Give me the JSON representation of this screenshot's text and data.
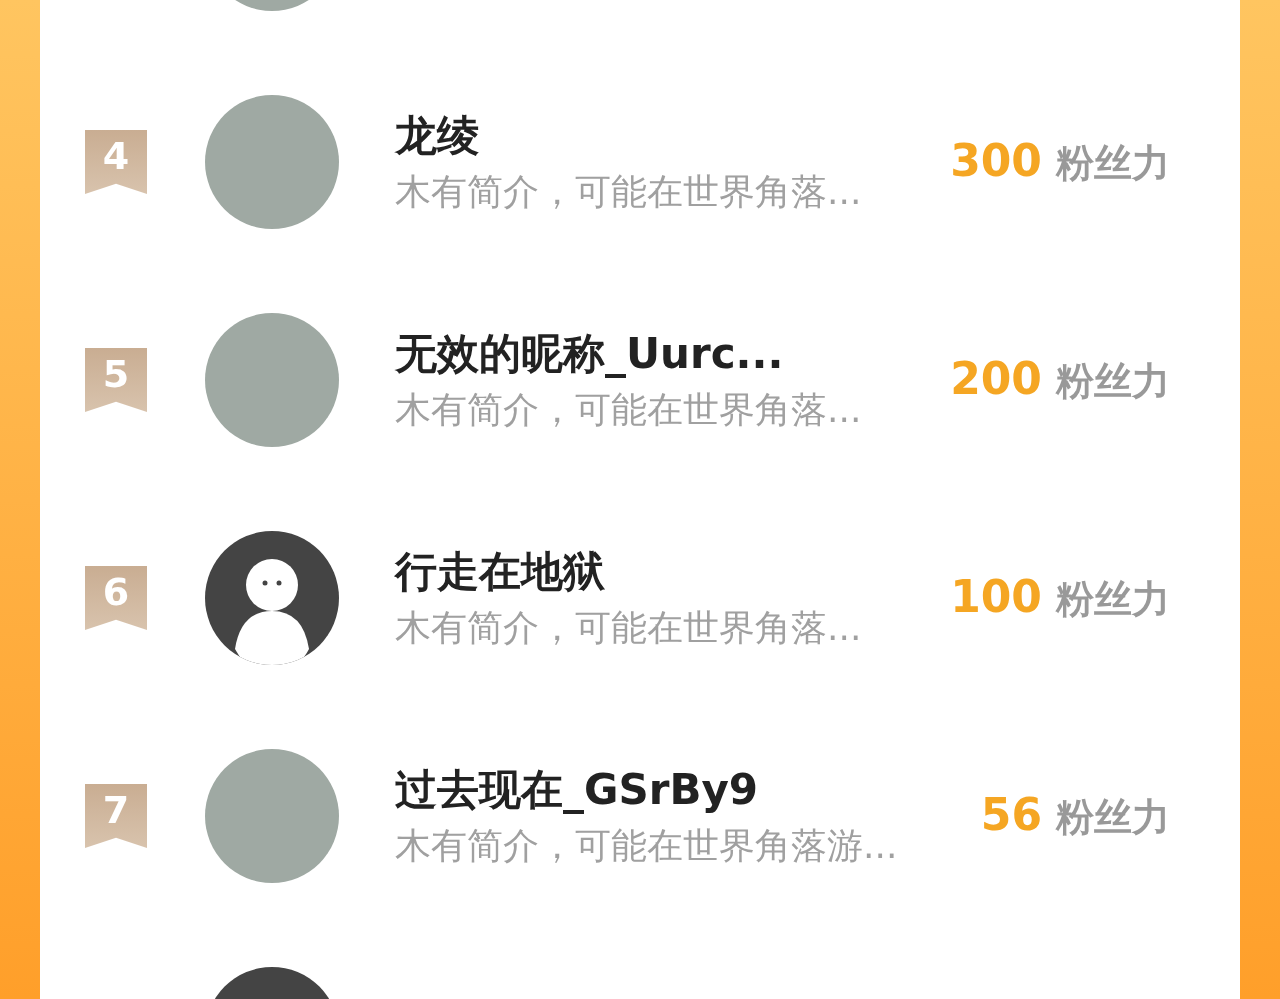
{
  "rows": [
    {
      "kind": "photo"
    },
    {
      "rank": "4",
      "kind": "photo",
      "name": "龙绫",
      "bio": "木有简介，可能在世界角落...",
      "score": "300",
      "unit": "粉丝力"
    },
    {
      "rank": "5",
      "kind": "photo",
      "name": "无效的昵称_Uurc...",
      "bio": "木有简介，可能在世界角落...",
      "score": "200",
      "unit": "粉丝力"
    },
    {
      "rank": "6",
      "kind": "default",
      "name": "行走在地狱",
      "bio": "木有简介，可能在世界角落...",
      "score": "100",
      "unit": "粉丝力"
    },
    {
      "rank": "7",
      "kind": "photo",
      "name": "过去现在_GSrBy9",
      "bio": "木有简介，可能在世界角落游...",
      "score": "56",
      "unit": "粉丝力"
    },
    {
      "kind": "blank"
    }
  ]
}
